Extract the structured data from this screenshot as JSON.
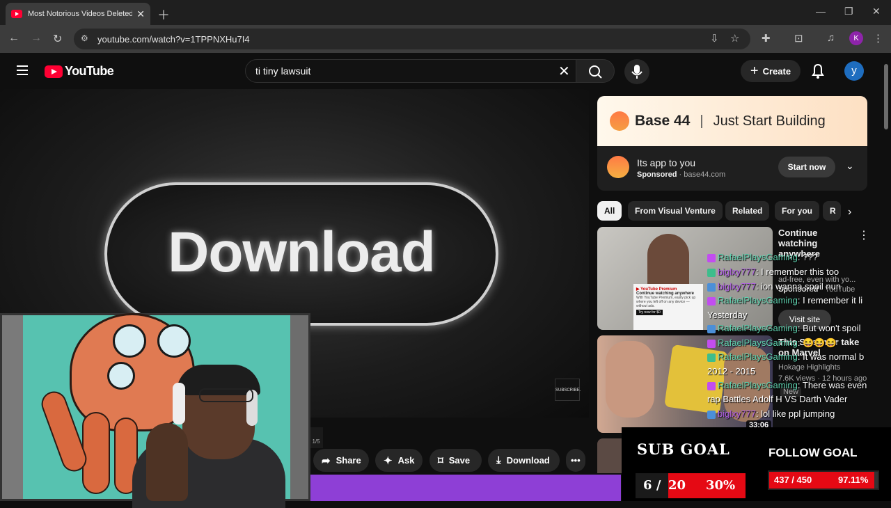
{
  "browser": {
    "tab_title": "Most Notorious Videos Deleted Fr",
    "url": "youtube.com/watch?v=1TPPNXHu7I4",
    "profile_initial": "K"
  },
  "youtube": {
    "logo_text": "YouTube",
    "search_value": "ti tiny lawsuit",
    "create_label": "Create",
    "avatar_initial": "y"
  },
  "video": {
    "overlay_text": "Download",
    "subscribe_tag": "SUBSCRIBE.",
    "page_indicator": "1/5"
  },
  "actions": {
    "share": "Share",
    "ask": "Ask",
    "save": "Save",
    "download": "Download"
  },
  "ad": {
    "brand": "Base 44",
    "tagline": "Just Start Building",
    "title": "Its app to you",
    "sponsored": "Sponsored",
    "domain": "base44.com",
    "cta": "Start now"
  },
  "chips": [
    "All",
    "From Visual Venture",
    "Related",
    "For you",
    "R"
  ],
  "recs": [
    {
      "title": "Continue watching anywhere",
      "meta1": "ad-free, even with yo...",
      "sponsored": "Sponsored",
      "channel": "YouTube",
      "cta": "Visit site",
      "panel_title": "Continue watching anywhere",
      "panel_body": "With YouTube Premium, easily pick up where you left off on any device — without ads.",
      "panel_btn": "Try now for $0"
    },
    {
      "title": "This Streamer take on Marvel",
      "channel": "Hokage Highlights",
      "meta": "7.6K views · 12 hours ago",
      "badge": "New",
      "duration": "33:06"
    }
  ],
  "chat": [
    {
      "user": "RafaelPlaysGaming",
      "msg": "???",
      "color": "#5fd3b0"
    },
    {
      "user": "biglxy777",
      "msg": "I remember this too",
      "color": "#b05ce6"
    },
    {
      "user": "biglxy777",
      "msg": "ion wanna spoil nun",
      "color": "#b05ce6"
    },
    {
      "user": "RafaelPlaysGaming",
      "msg": "I remember it li",
      "color": "#5fd3b0"
    },
    {
      "user": "",
      "msg": "Yesterday",
      "color": "#fff"
    },
    {
      "user": "RafaelPlaysGaming",
      "msg": "But won't spoil",
      "color": "#5fd3b0"
    },
    {
      "user": "RafaelPlaysGaming",
      "msg": "😆😆😆",
      "color": "#5fd3b0"
    },
    {
      "user": "RafaelPlaysGaming",
      "msg": "It was normal b",
      "color": "#5fd3b0"
    },
    {
      "user": "",
      "msg": "2012 - 2015",
      "color": "#fff"
    },
    {
      "user": "RafaelPlaysGaming",
      "msg": "There was even",
      "color": "#5fd3b0"
    },
    {
      "user": "",
      "msg": "rap Battles Adolf H VS Darth Vader",
      "color": "#fff"
    },
    {
      "user": "biglxy777",
      "msg": "lol like ppl jumping",
      "color": "#b05ce6"
    }
  ],
  "goals": {
    "sub_title": "SUB GOAL",
    "sub_current": "6",
    "sub_sep": "/",
    "sub_target": "20",
    "sub_pct": "30%",
    "sub_fraction": 0.3,
    "follow_title": "FOLLOW GOAL",
    "follow_count": "437 / 450",
    "follow_pct": "97.11%",
    "follow_fraction": 0.9711
  }
}
